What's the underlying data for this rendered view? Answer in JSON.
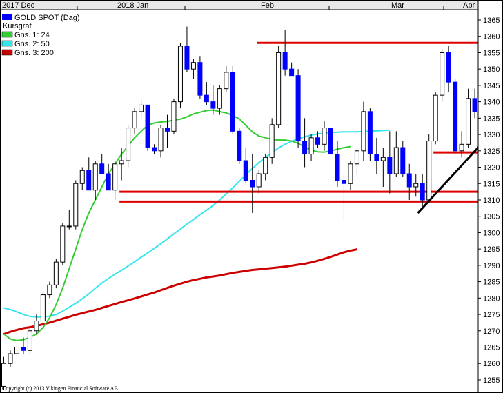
{
  "chart_data": {
    "type": "candlestick",
    "title": "GOLD SPOT (Dag)",
    "legend": [
      "Kursgraf",
      "Gns. 1: 24",
      "Gns. 2: 50",
      "Gns. 3: 200"
    ],
    "legend_placement": "top-left",
    "copyright": "Copyright (c) 2013 Vikingen Financial Software AB",
    "months": [
      "2017 Dec",
      "2018 Jan",
      "Feb",
      "Mar",
      "Apr"
    ],
    "y_ticks": [
      1255,
      1260,
      1265,
      1270,
      1275,
      1280,
      1285,
      1290,
      1295,
      1300,
      1305,
      1310,
      1315,
      1320,
      1325,
      1330,
      1335,
      1340,
      1345,
      1350,
      1355,
      1360,
      1365
    ],
    "ylim": [
      1252,
      1368
    ],
    "grid": false,
    "colors": {
      "up": "#ffffff",
      "down": "#0000ff",
      "wick": "#000000",
      "ma24": "#33cc33",
      "ma50": "#33e6ee",
      "ma200": "#cc0000",
      "level": "#dd0000",
      "trend": "#000000"
    },
    "candles": [
      [
        1253,
        1262,
        1252,
        1260
      ],
      [
        1260,
        1264,
        1259,
        1263
      ],
      [
        1263,
        1266,
        1262,
        1265
      ],
      [
        1265,
        1268,
        1263,
        1264
      ],
      [
        1264,
        1271,
        1263,
        1270
      ],
      [
        1270,
        1275,
        1269,
        1273
      ],
      [
        1273,
        1282,
        1273,
        1281
      ],
      [
        1281,
        1285,
        1280,
        1284
      ],
      [
        1284,
        1292,
        1283,
        1291
      ],
      [
        1291,
        1303,
        1290,
        1302
      ],
      [
        1302,
        1307,
        1301,
        1302
      ],
      [
        1302,
        1316,
        1301,
        1315
      ],
      [
        1315,
        1320,
        1313,
        1319
      ],
      [
        1319,
        1323,
        1316,
        1313
      ],
      [
        1313,
        1322,
        1310,
        1321
      ],
      [
        1321,
        1324,
        1319,
        1318
      ],
      [
        1318,
        1321,
        1313,
        1313
      ],
      [
        1313,
        1322,
        1310,
        1321
      ],
      [
        1321,
        1326,
        1316,
        1322
      ],
      [
        1322,
        1333,
        1320,
        1332
      ],
      [
        1332,
        1338,
        1330,
        1337
      ],
      [
        1337,
        1341,
        1335,
        1339
      ],
      [
        1339,
        1338,
        1325,
        1326
      ],
      [
        1326,
        1327,
        1324,
        1325
      ],
      [
        1325,
        1333,
        1323,
        1332
      ],
      [
        1332,
        1336,
        1326,
        1331
      ],
      [
        1331,
        1341,
        1330,
        1340
      ],
      [
        1340,
        1358,
        1338,
        1357
      ],
      [
        1357,
        1363,
        1349,
        1350
      ],
      [
        1350,
        1353,
        1347,
        1352
      ],
      [
        1352,
        1354,
        1341,
        1342
      ],
      [
        1342,
        1346,
        1339,
        1340
      ],
      [
        1340,
        1345,
        1336,
        1338
      ],
      [
        1338,
        1345,
        1336,
        1344
      ],
      [
        1344,
        1351,
        1343,
        1349
      ],
      [
        1349,
        1351,
        1330,
        1331
      ],
      [
        1331,
        1332,
        1321,
        1322
      ],
      [
        1322,
        1326,
        1315,
        1316
      ],
      [
        1316,
        1324,
        1306,
        1314
      ],
      [
        1314,
        1319,
        1312,
        1318
      ],
      [
        1318,
        1324,
        1316,
        1323
      ],
      [
        1323,
        1335,
        1321,
        1333
      ],
      [
        1333,
        1357,
        1332,
        1355
      ],
      [
        1355,
        1362,
        1348,
        1350
      ],
      [
        1350,
        1352,
        1348,
        1348
      ],
      [
        1348,
        1350,
        1326,
        1328
      ],
      [
        1328,
        1335,
        1320,
        1324
      ],
      [
        1324,
        1330,
        1322,
        1329
      ],
      [
        1329,
        1331,
        1326,
        1327
      ],
      [
        1327,
        1334,
        1325,
        1332
      ],
      [
        1332,
        1336,
        1323,
        1324
      ],
      [
        1324,
        1328,
        1314,
        1316
      ],
      [
        1316,
        1318,
        1304,
        1315
      ],
      [
        1315,
        1322,
        1313,
        1321
      ],
      [
        1321,
        1326,
        1318,
        1325
      ],
      [
        1325,
        1340,
        1322,
        1337
      ],
      [
        1337,
        1338,
        1322,
        1324
      ],
      [
        1324,
        1329,
        1318,
        1322
      ],
      [
        1322,
        1326,
        1314,
        1323
      ],
      [
        1323,
        1331,
        1312,
        1318
      ],
      [
        1318,
        1331,
        1317,
        1326
      ],
      [
        1326,
        1328,
        1317,
        1318
      ],
      [
        1318,
        1321,
        1310,
        1314
      ],
      [
        1314,
        1318,
        1311,
        1315
      ],
      [
        1315,
        1318,
        1308,
        1310
      ],
      [
        1310,
        1330,
        1309,
        1328
      ],
      [
        1328,
        1343,
        1327,
        1342
      ],
      [
        1342,
        1356,
        1340,
        1355
      ],
      [
        1355,
        1357,
        1343,
        1346
      ],
      [
        1346,
        1347,
        1324,
        1325
      ],
      [
        1325,
        1331,
        1323,
        1327
      ],
      [
        1327,
        1344,
        1326,
        1341
      ],
      [
        1341,
        1344,
        1335,
        1337
      ]
    ],
    "ma24": [
      1269,
      1267.5,
      1267,
      1267.3,
      1268,
      1269,
      1271,
      1274,
      1278,
      1283,
      1289,
      1295,
      1301,
      1306,
      1310,
      1314,
      1318,
      1321,
      1324,
      1326.5,
      1329,
      1331,
      1332.8,
      1333.5,
      1333.8,
      1334,
      1334.4,
      1334.7,
      1335.4,
      1336.3,
      1336.8,
      1337.3,
      1337.5,
      1337,
      1336.6,
      1335.8,
      1334.8,
      1332.8,
      1330.8,
      1329.5,
      1329,
      1328.5,
      1328.3,
      1328.3,
      1328,
      1327.3,
      1326.2,
      1325.2,
      1324.7,
      1324.6,
      1325,
      1325.5,
      1326,
      1326.3
    ],
    "ma50": [
      1277,
      1276.5,
      1275.8,
      1275,
      1274.4,
      1274.2,
      1274.2,
      1274.5,
      1275,
      1276,
      1277.2,
      1278.4,
      1279.8,
      1281.3,
      1283,
      1284.6,
      1286,
      1287.3,
      1288.5,
      1289.8,
      1291.1,
      1292.5,
      1293.8,
      1295.2,
      1296.6,
      1298.1,
      1299.6,
      1301.1,
      1302.6,
      1304,
      1305.5,
      1306.9,
      1308.3,
      1310,
      1311.8,
      1313.7,
      1315.7,
      1317.7,
      1319.6,
      1321.4,
      1323,
      1324.5,
      1325.9,
      1327,
      1327.9,
      1328.7,
      1329.3,
      1329.8,
      1330.2,
      1330.4,
      1330.6,
      1330.7,
      1330.8,
      1330.8,
      1330.8,
      1330.9,
      1331,
      1331.1,
      1331.2,
      1331.3
    ],
    "ma200": [
      1269,
      1269.7,
      1270.3,
      1270.8,
      1271.1,
      1271.5,
      1272,
      1272.5,
      1273.1,
      1273.7,
      1274.3,
      1274.9,
      1275.4,
      1275.9,
      1276.4,
      1277,
      1277.6,
      1278.2,
      1278.8,
      1279.3,
      1279.9,
      1280.5,
      1281.1,
      1281.7,
      1282.4,
      1283.1,
      1283.8,
      1284.4,
      1285,
      1285.5,
      1285.9,
      1286.3,
      1286.6,
      1286.9,
      1287.3,
      1287.7,
      1288,
      1288.3,
      1288.6,
      1288.8,
      1289,
      1289.2,
      1289.4,
      1289.6,
      1289.9,
      1290.2,
      1290.5,
      1290.9,
      1291.4,
      1292,
      1292.6,
      1293.3,
      1294,
      1294.5,
      1294.9
    ],
    "levels": [
      {
        "y": 1358,
        "x0": 39,
        "x1": 73
      },
      {
        "y": 1312.5,
        "x0": 18,
        "x1": 73
      },
      {
        "y": 1309.5,
        "x0": 18,
        "x1": 73
      },
      {
        "y": 1324.5,
        "x0": 66,
        "x1": 73
      }
    ],
    "trendlines": [
      {
        "x0": 63.3,
        "y0": 1306,
        "x1": 73.2,
        "y1": 1327.5
      }
    ]
  }
}
